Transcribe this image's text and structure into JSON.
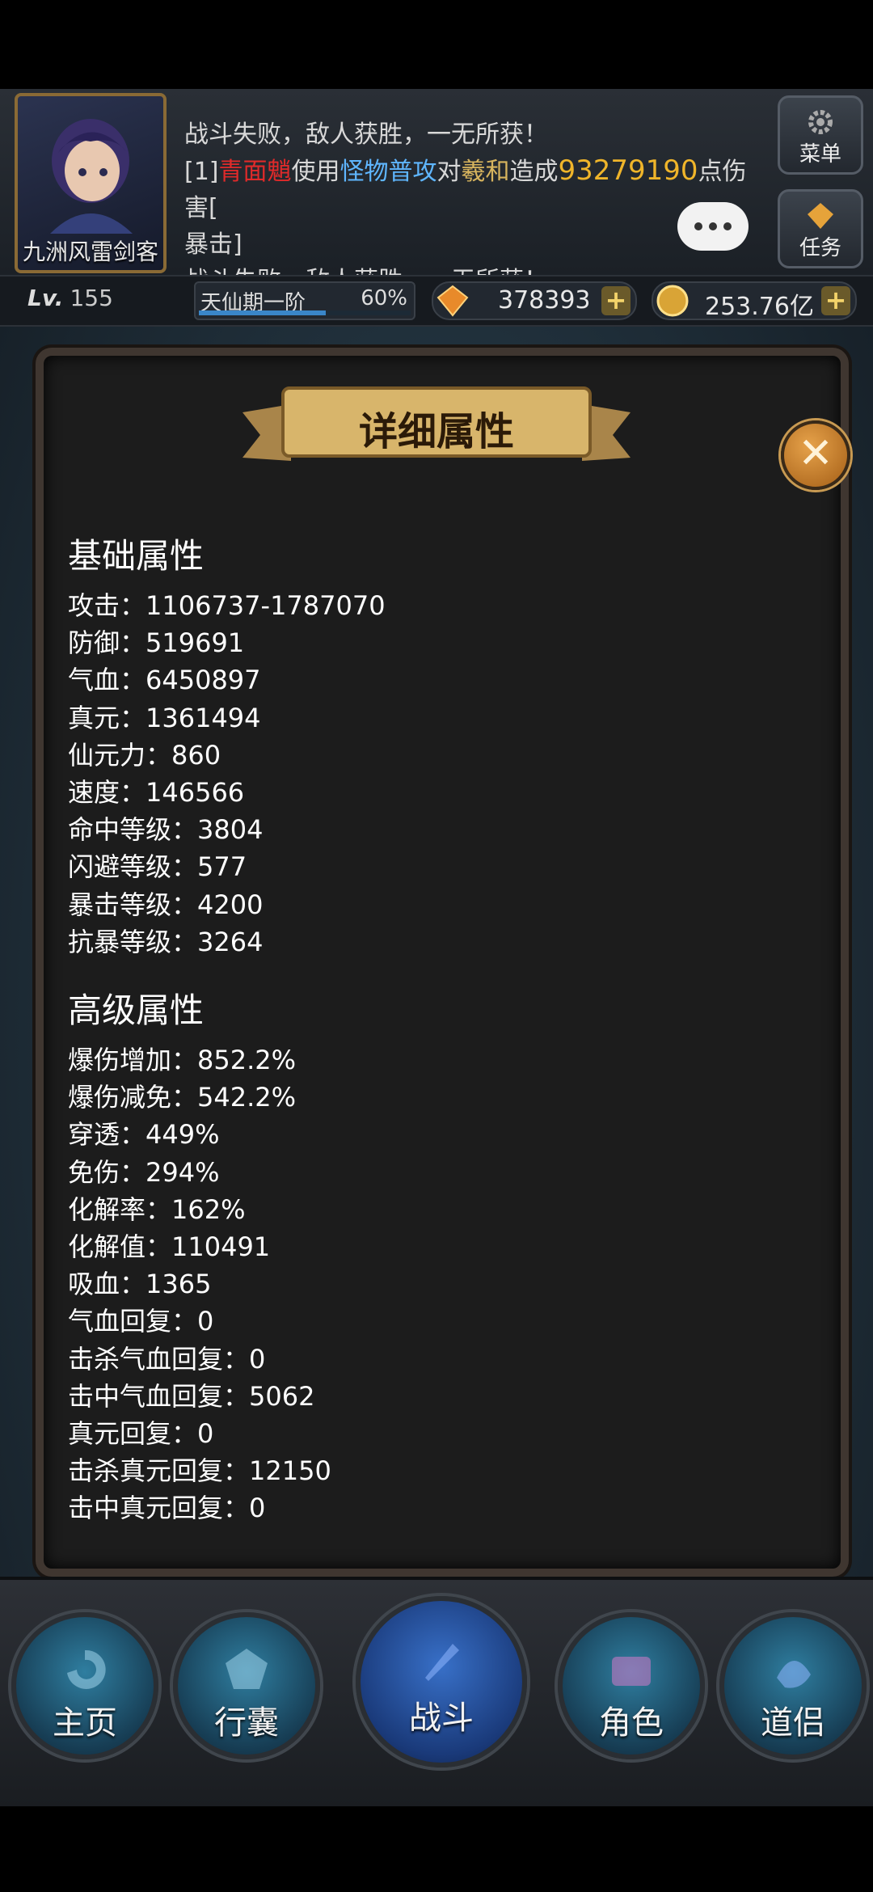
{
  "header": {
    "player_name": "九洲风雷剑客",
    "chat": {
      "line1": "战斗失败，敌人获胜，一无所获！",
      "line2_prefix": "[1]",
      "line2_attacker": "青面魈",
      "line2_verb": "使用",
      "line2_skill": "怪物普攻",
      "line2_to": "对",
      "line2_target": "羲和",
      "line2_cause": "造成",
      "line2_damage": "93279190",
      "line2_suffix": "点伤害[",
      "line2_cont": "暴击]",
      "line3": "战斗失败，敌人获胜，一无所获！"
    },
    "menu_label": "菜单",
    "task_label": "任务"
  },
  "status": {
    "level_prefix": "Lv.",
    "level": "155",
    "realm": "天仙期一阶",
    "realm_progress": "60%",
    "realm_progress_value": 0.6,
    "gems": "378393",
    "coins": "253.76亿"
  },
  "page_title": "角色",
  "dialog": {
    "title": "详细属性",
    "basic_title": "基础属性",
    "basic": [
      "攻击：1106737-1787070",
      "防御：519691",
      "气血：6450897",
      "真元：1361494",
      "仙元力：860",
      "速度：146566",
      "命中等级：3804",
      "闪避等级：577",
      "暴击等级：4200",
      "抗暴等级：3264"
    ],
    "advanced_title": "高级属性",
    "advanced": [
      "爆伤增加：852.2%",
      "爆伤减免：542.2%",
      "穿透：449%",
      "免伤：294%",
      "化解率：162%",
      "化解值：110491",
      "吸血：1365",
      "气血回复：0",
      "击杀气血回复：0",
      "击中气血回复：5062",
      "真元回复：0",
      "击杀真元回复：12150",
      "击中真元回复：0"
    ]
  },
  "nav": {
    "home": "主页",
    "bag": "行囊",
    "battle": "战斗",
    "role": "角色",
    "partner": "道侣"
  },
  "colors": {
    "attacker": "#e12a2a",
    "skill": "#5fb6ff",
    "damage": "#f0b52a",
    "ribbon": "#c9a25a"
  }
}
